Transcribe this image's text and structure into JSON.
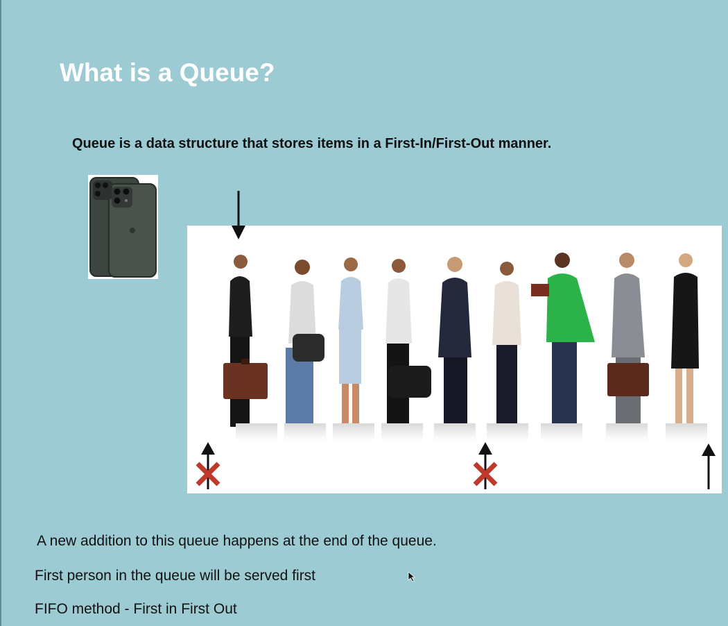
{
  "slide": {
    "title": "What is a Queue?",
    "subtitle": "Queue is a data structure that stores items in a First-In/First-Out manner."
  },
  "bullets": [
    "A new addition to this queue happens at the end of the queue.",
    "First person in the queue will be served first",
    "FIFO method - First in First Out"
  ],
  "illustration": {
    "phone_image": "iphone-icon",
    "queue_image": "people-in-line-illustration",
    "marker_icons": [
      "add-arrow-down-icon",
      "blocked-arrow-up-icon",
      "blocked-arrow-up-icon",
      "exit-arrow-up-icon"
    ]
  },
  "colors": {
    "background": "#9ccbd3",
    "title": "#ffffff",
    "text": "#111111",
    "cross_mark": "#c0392b"
  }
}
